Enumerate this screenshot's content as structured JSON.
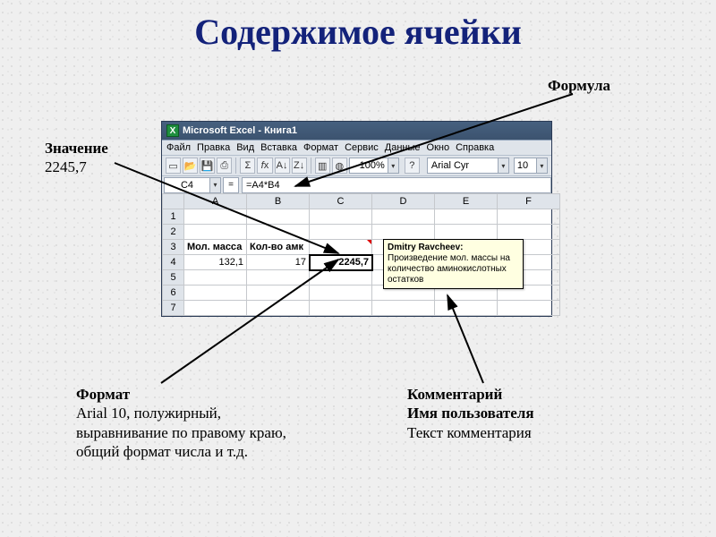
{
  "slide": {
    "title": "Содержимое ячейки"
  },
  "callouts": {
    "formula": {
      "label": "Формула"
    },
    "value": {
      "label": "Значение",
      "text": "2245,7"
    },
    "comment": {
      "label": "Комментарий",
      "l2": "Имя пользователя",
      "l3": "Текст комментария"
    },
    "format": {
      "label": "Формат",
      "l2": "Arial 10, полужирный,",
      "l3": " выравнивание по правому краю,",
      "l4": "общий формат числа и т.д."
    }
  },
  "excel": {
    "title": "Microsoft Excel - Книга1",
    "menu": [
      "Файл",
      "Правка",
      "Вид",
      "Вставка",
      "Формат",
      "Сервис",
      "Данные",
      "Окно",
      "Справка"
    ],
    "zoom": "100%",
    "font": "Arial Cyr",
    "font_size": "10",
    "namebox": "C4",
    "fx_label": "=",
    "formula": "=A4*B4",
    "columns": [
      "A",
      "B",
      "C",
      "D",
      "E",
      "F"
    ],
    "rows": [
      "1",
      "2",
      "3",
      "4",
      "5",
      "6",
      "7"
    ],
    "cells": {
      "A3": "Мол. масса",
      "B3": "Кол-во амк",
      "A4": "132,1",
      "B4": "17",
      "C4": "2245,7"
    },
    "comment": {
      "user": "Dmitry Ravcheev:",
      "body": "Произведение мол. массы на количество аминокислотных остатков"
    }
  }
}
